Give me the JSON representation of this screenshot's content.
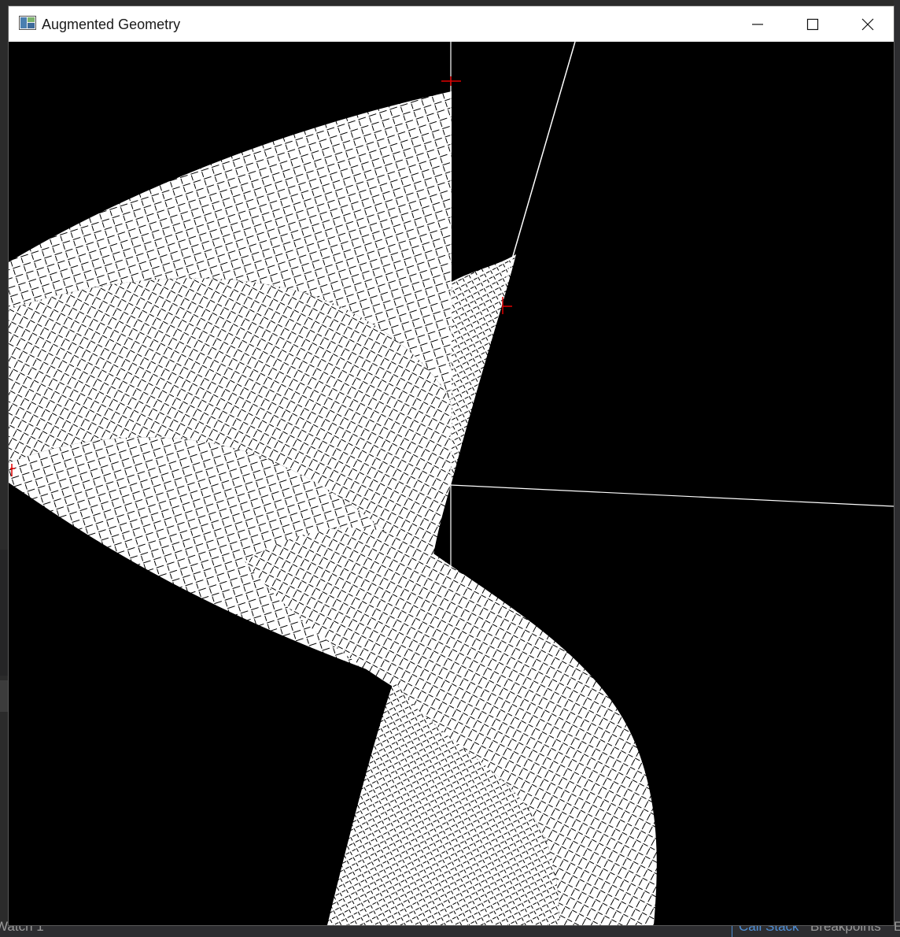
{
  "window": {
    "title": "Augmented Geometry",
    "app_icon": "window-app-icon",
    "controls": [
      "minimize-icon",
      "maximize-icon",
      "close-icon"
    ]
  },
  "background": {
    "tabs": [
      {
        "label": "Watch 1",
        "active": false
      },
      {
        "label": "Call Stack",
        "active": true
      },
      {
        "label": "Breakpoints",
        "active": false
      },
      {
        "label": "E",
        "active": false
      }
    ]
  },
  "colors": {
    "surface_fill": "#ffffff",
    "mesh_line": "#000000",
    "axis_line": "#ffffff",
    "marker": "#ff0000",
    "canvas_bg": "#000000"
  }
}
